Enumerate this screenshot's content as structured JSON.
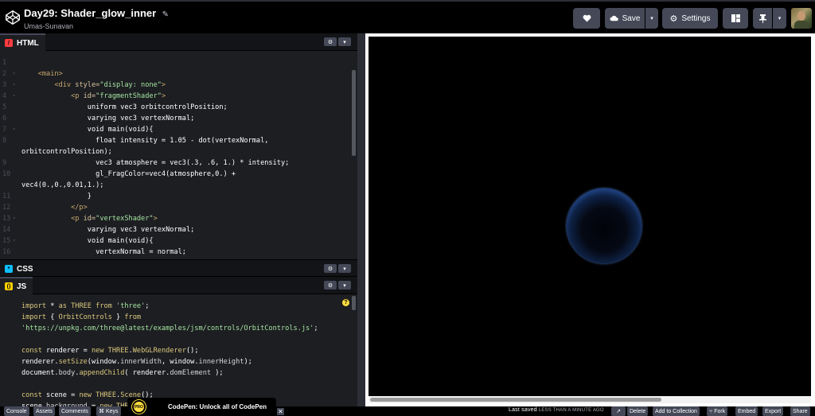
{
  "header": {
    "title": "Day29: Shader_glow_inner",
    "author": "Umas-Sunavan",
    "save_label": "Save",
    "settings_label": "Settings"
  },
  "editors": {
    "html": {
      "label": "HTML",
      "badge": "/",
      "color": "#ff3c41"
    },
    "css": {
      "label": "CSS",
      "badge": "*",
      "color": "#0ebeff"
    },
    "js": {
      "label": "JS",
      "badge": "()",
      "color": "#fcd000"
    }
  },
  "html_lines": [
    {
      "n": "1",
      "fold": "",
      "parts": []
    },
    {
      "n": "2",
      "fold": "▾",
      "parts": [
        [
          "t-tag",
          "    <main>"
        ]
      ]
    },
    {
      "n": "3",
      "fold": "▾",
      "parts": [
        [
          "t-tag",
          "        <div "
        ],
        [
          "t-attr",
          "style="
        ],
        [
          "t-str",
          "\"display: none\""
        ],
        [
          "t-tag",
          ">"
        ]
      ]
    },
    {
      "n": "4",
      "fold": "▾",
      "parts": [
        [
          "t-tag",
          "            <p "
        ],
        [
          "t-attr",
          "id="
        ],
        [
          "t-str",
          "\"fragmentShader\""
        ],
        [
          "t-tag",
          ">"
        ]
      ]
    },
    {
      "n": "5",
      "fold": "",
      "parts": [
        [
          "",
          "                uniform vec3 orbitcontrolPosition;"
        ]
      ]
    },
    {
      "n": "6",
      "fold": "",
      "parts": [
        [
          "",
          "                varying vec3 vertexNormal;"
        ]
      ]
    },
    {
      "n": "7",
      "fold": "▾",
      "parts": [
        [
          "",
          "                void main(void){"
        ]
      ]
    },
    {
      "n": "8",
      "fold": "",
      "parts": [
        [
          "",
          "                  float intensity = 1.05 - dot(vertexNormal,"
        ]
      ]
    },
    {
      "n": "",
      "fold": "",
      "parts": [
        [
          "",
          "orbitcontrolPosition);"
        ]
      ]
    },
    {
      "n": "9",
      "fold": "",
      "parts": [
        [
          "",
          "                  vec3 atmosphere = vec3(.3, .6, 1.) * intensity;"
        ]
      ]
    },
    {
      "n": "10",
      "fold": "",
      "parts": [
        [
          "",
          "                  gl_FragColor=vec4(atmosphere,0.) +"
        ]
      ]
    },
    {
      "n": "",
      "fold": "",
      "parts": [
        [
          "",
          "vec4(0.,0.,0.01,1.);"
        ]
      ]
    },
    {
      "n": "11",
      "fold": "",
      "parts": [
        [
          "",
          "                }"
        ]
      ]
    },
    {
      "n": "12",
      "fold": "",
      "parts": [
        [
          "t-tag",
          "            </p>"
        ]
      ]
    },
    {
      "n": "13",
      "fold": "▾",
      "parts": [
        [
          "t-tag",
          "            <p "
        ],
        [
          "t-attr",
          "id="
        ],
        [
          "t-str",
          "\"vertexShader\""
        ],
        [
          "t-tag",
          ">"
        ]
      ]
    },
    {
      "n": "14",
      "fold": "",
      "parts": [
        [
          "",
          "                varying vec3 vertexNormal;"
        ]
      ]
    },
    {
      "n": "15",
      "fold": "▾",
      "parts": [
        [
          "",
          "                void main(void){"
        ]
      ]
    },
    {
      "n": "16",
      "fold": "",
      "parts": [
        [
          "",
          "                  vertexNormal = normal;"
        ]
      ]
    },
    {
      "n": "17",
      "fold": "",
      "parts": []
    }
  ],
  "js_lines": [
    {
      "parts": [
        [
          "t-kw",
          "import"
        ],
        [
          "",
          " * "
        ],
        [
          "t-kw",
          "as"
        ],
        [
          "t-cls",
          " THREE "
        ],
        [
          "t-kw",
          "from"
        ],
        [
          "t-str",
          " 'three'"
        ],
        [
          "",
          ";"
        ]
      ]
    },
    {
      "parts": [
        [
          "t-kw",
          "import"
        ],
        [
          "",
          " { "
        ],
        [
          "t-cls",
          "OrbitControls"
        ],
        [
          "",
          " } "
        ],
        [
          "t-kw",
          "from"
        ]
      ]
    },
    {
      "parts": [
        [
          "t-str",
          "'https://unpkg.com/three@latest/examples/jsm/controls/OrbitControls.js'"
        ],
        [
          "",
          ";"
        ]
      ]
    },
    {
      "parts": []
    },
    {
      "parts": [
        [
          "t-kw",
          "const"
        ],
        [
          "",
          " renderer = "
        ],
        [
          "t-kw",
          "new"
        ],
        [
          "t-cls",
          " THREE"
        ],
        [
          "",
          "."
        ],
        [
          "t-cls",
          "WebGLRenderer"
        ],
        [
          "",
          "();"
        ]
      ]
    },
    {
      "parts": [
        [
          "",
          "renderer."
        ],
        [
          "t-mod",
          "setSize"
        ],
        [
          "",
          "(window."
        ],
        [
          "t-prop",
          "innerWidth"
        ],
        [
          "",
          ", window."
        ],
        [
          "t-prop",
          "innerHeight"
        ],
        [
          "",
          ");"
        ]
      ]
    },
    {
      "parts": [
        [
          "",
          "document."
        ],
        [
          "t-prop",
          "body"
        ],
        [
          "",
          "."
        ],
        [
          "t-mod",
          "appendChild"
        ],
        [
          "",
          "( renderer."
        ],
        [
          "t-prop",
          "domElement"
        ],
        [
          "",
          " );"
        ]
      ]
    },
    {
      "parts": []
    },
    {
      "parts": [
        [
          "t-kw",
          "const"
        ],
        [
          "",
          " scene = "
        ],
        [
          "t-kw",
          "new"
        ],
        [
          "t-cls",
          " THREE"
        ],
        [
          "",
          "."
        ],
        [
          "t-cls",
          "Scene"
        ],
        [
          "",
          "();"
        ]
      ]
    },
    {
      "parts": [
        [
          "",
          "scene."
        ],
        [
          "t-prop",
          "background"
        ],
        [
          "",
          " = "
        ],
        [
          "t-kw",
          "new"
        ],
        [
          "t-cls",
          " THREE"
        ]
      ]
    }
  ],
  "footer": {
    "console": "Console",
    "assets": "Assets",
    "comments": "Comments",
    "keys": "⌘ Keys",
    "pro_badge": "PRO",
    "pro_text": "CodePen: Unlock all of CodePen",
    "close": "✕",
    "last_saved": "Last saved",
    "last_saved_when": "LESS THAN A MINUTE AGO",
    "delete": "Delete",
    "add_to_collection": "Add to Collection",
    "fork": "Fork",
    "embed": "Embed",
    "export": "Export",
    "share": "Share"
  },
  "icons": {
    "heart": "heart-icon",
    "cloud": "cloud-icon",
    "gear": "gear-icon",
    "layout": "layout-icon",
    "pin": "pin-icon",
    "chevron": "chevron-down-icon"
  },
  "colors": {
    "accent_button": "#444857",
    "editor_bg": "#1d1e22",
    "page_bg": "#131417",
    "orb_blue": "#4f86e0"
  }
}
